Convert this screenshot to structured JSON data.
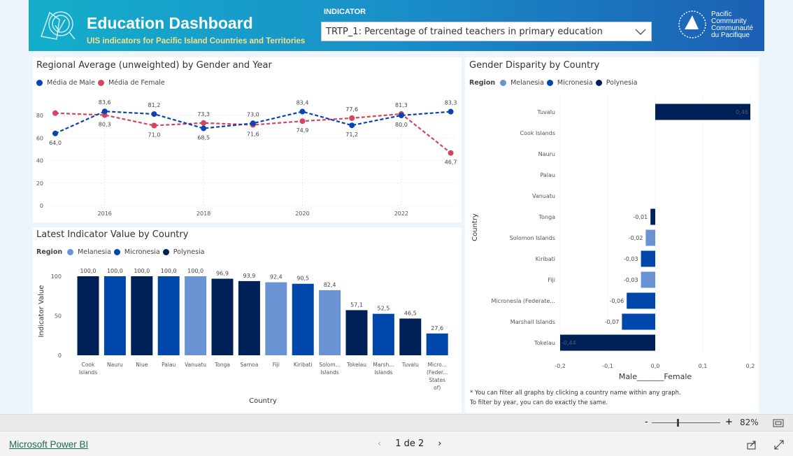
{
  "header": {
    "title": "Education Dashboard",
    "subtitle": "UIS indicators for Pacific Island Countries and Territories",
    "indicator_label": "INDICATOR",
    "indicator_value": "TRTP_1: Percentage of trained teachers in primary education",
    "org_line1": "Pacific",
    "org_line2": "Community",
    "org_line3": "Communauté",
    "org_line4": "du Pacifique"
  },
  "colors": {
    "male": "#0a44b0",
    "female": "#d64560",
    "melanesia": "#6a93d4",
    "micronesia": "#0047ab",
    "polynesia": "#002157"
  },
  "chart_data": [
    {
      "type": "line",
      "title": "Regional Average (unweighted) by Gender and Year",
      "x": [
        2015,
        2016,
        2017,
        2018,
        2019,
        2020,
        2021,
        2022,
        2023
      ],
      "xticks": [
        2016,
        2018,
        2020,
        2022
      ],
      "yticks": [
        0,
        20,
        40,
        60,
        80
      ],
      "ylim": [
        0,
        90
      ],
      "grid": true,
      "legend": "top-left",
      "series": [
        {
          "name": "Média de Male",
          "values": [
            64.0,
            83.6,
            81.2,
            68.5,
            73.0,
            83.4,
            71.2,
            80.0,
            83.3
          ],
          "labels": [
            "64,0",
            "83,6",
            "81,2",
            "68,5",
            "73,0",
            "83,4",
            "71,2",
            "80,0",
            "83,3"
          ]
        },
        {
          "name": "Média de Female",
          "values": [
            82.0,
            80.3,
            71.0,
            73.3,
            71.6,
            74.9,
            77.6,
            81.3,
            46.7
          ],
          "labels": [
            "",
            "80,3",
            "71,0",
            "73,3",
            "71,6",
            "74,9",
            "77,6",
            "81,3",
            "46,7"
          ]
        }
      ]
    },
    {
      "type": "bar",
      "title": "Latest Indicator Value by Country",
      "xlabel": "Country",
      "ylabel": "Indicator Value",
      "legend_title": "Region",
      "legend": [
        "Melanesia",
        "Micronesia",
        "Polynesia"
      ],
      "yticks": [
        0,
        50,
        100
      ],
      "ylim": [
        0,
        100
      ],
      "categories": [
        "Cook Islands",
        "Nauru",
        "Niue",
        "Palau",
        "Vanuatu",
        "Tonga",
        "Samoa",
        "Fiji",
        "Kiribati",
        "Solom... Islands",
        "Tokelau",
        "Marsh... Islands",
        "Tuvalu",
        "Micro... (Feder... States of)"
      ],
      "values": [
        100.0,
        100.0,
        100.0,
        100.0,
        100.0,
        96.9,
        93.9,
        92.4,
        90.5,
        82.4,
        57.1,
        52.5,
        46.5,
        27.6
      ],
      "labels": [
        "100,0",
        "100,0",
        "100,0",
        "100,0",
        "100,0",
        "96,9",
        "93,9",
        "92,4",
        "90,5",
        "82,4",
        "57,1",
        "52,5",
        "46,5",
        "27,6"
      ],
      "regions": [
        "Polynesia",
        "Micronesia",
        "Polynesia",
        "Micronesia",
        "Melanesia",
        "Polynesia",
        "Polynesia",
        "Melanesia",
        "Micronesia",
        "Melanesia",
        "Polynesia",
        "Micronesia",
        "Polynesia",
        "Micronesia"
      ]
    },
    {
      "type": "bar",
      "orientation": "horizontal",
      "title": "Gender Disparity by Country",
      "xlabel": "Male_______Female",
      "ylabel": "Country",
      "legend_title": "Region",
      "legend": [
        "Melanesia",
        "Micronesia",
        "Polynesia"
      ],
      "xlim": [
        -0.2,
        0.2
      ],
      "xticks": [
        "-0,2",
        "-0,1",
        "0,0",
        "0,1",
        "0,2"
      ],
      "categories": [
        "Tuvalu",
        "Cook Islands",
        "Nauru",
        "Palau",
        "Vanuatu",
        "Tonga",
        "Solomon Islands",
        "Kiribati",
        "Fiji",
        "Micronesia (Federate...",
        "Marshall Islands",
        "Tokelau"
      ],
      "values": [
        0.46,
        0,
        0,
        0,
        0,
        -0.01,
        -0.02,
        -0.03,
        -0.03,
        -0.06,
        -0.07,
        -0.44
      ],
      "labels": [
        "0,46",
        "",
        "",
        "",
        "",
        "-0,01",
        "-0,02",
        "-0,03",
        "-0,03",
        "-0,06",
        "-0,07",
        "-0,44"
      ],
      "regions": [
        "Polynesia",
        "Polynesia",
        "Micronesia",
        "Micronesia",
        "Melanesia",
        "Polynesia",
        "Melanesia",
        "Micronesia",
        "Melanesia",
        "Micronesia",
        "Micronesia",
        "Polynesia"
      ]
    }
  ],
  "notes": {
    "line1": "* You can filter all graphs by clicking a country name within any graph.",
    "line2": "To filter by year, you can do exactly the same."
  },
  "zoom": {
    "level": "82%",
    "minus": "-",
    "plus": "+",
    "value_percent": 82
  },
  "footer": {
    "brand": "Microsoft Power BI",
    "page": "1 de 2"
  }
}
